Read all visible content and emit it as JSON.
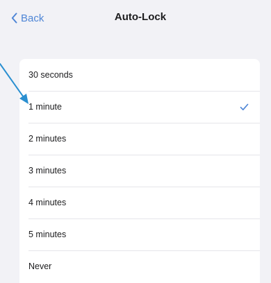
{
  "nav": {
    "back_label": "Back",
    "title": "Auto-Lock"
  },
  "options": [
    {
      "label": "30 seconds",
      "selected": false
    },
    {
      "label": "1 minute",
      "selected": true
    },
    {
      "label": "2 minutes",
      "selected": false
    },
    {
      "label": "3 minutes",
      "selected": false
    },
    {
      "label": "4 minutes",
      "selected": false
    },
    {
      "label": "5 minutes",
      "selected": false
    },
    {
      "label": "Never",
      "selected": false
    }
  ],
  "colors": {
    "background": "#f2f2f6",
    "card": "#ffffff",
    "accent": "#4f86d6",
    "annotation_arrow": "#2a8fd0"
  },
  "icons": {
    "back": "chevron-left-icon",
    "selected": "checkmark-icon",
    "annotation": "pointer-arrow-icon"
  }
}
